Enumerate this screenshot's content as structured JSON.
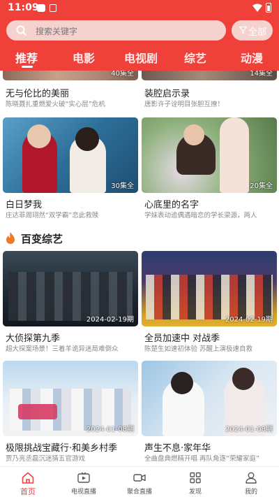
{
  "status_bar": {
    "time": "11:09"
  },
  "search": {
    "placeholder": "搜索关键字",
    "filter_label": "全部"
  },
  "tabs": [
    {
      "label": "推荐",
      "active": true
    },
    {
      "label": "电影"
    },
    {
      "label": "电视剧"
    },
    {
      "label": "综艺"
    },
    {
      "label": "动漫"
    }
  ],
  "drama_cards": [
    {
      "title": "无与伦比的美丽",
      "desc": "陈晓聂扎重燃爱火破“实心层”危机",
      "badge": "40集全"
    },
    {
      "title": "装腔启示录",
      "desc": "唐影许子诠明目张胆互撩！",
      "badge": "14集全"
    },
    {
      "title": "白日梦我",
      "desc": "庄达菲周翊然“双学霸”恋此救赎",
      "badge": "30集全"
    },
    {
      "title": "心底里的名字",
      "desc": "学妹表动追偶遇暗恋的学长梁源，两人",
      "badge": "20集全"
    }
  ],
  "variety_section": {
    "title": "百变综艺"
  },
  "variety_cards": [
    {
      "title": "大侦探第九季",
      "desc": "超大探案场景！三着羊诡异迷局难倒众",
      "badge": "2024-02-19期"
    },
    {
      "title": "全员加速中 对战季",
      "desc": "陈楚生如速初体验 苏醒上演极速自救",
      "badge": "2024-02-19期"
    },
    {
      "title": "极限挑战宝藏行·和美乡村季",
      "desc": "贾乃亮丞磊沉迷猜五官游戏",
      "badge": "2024-01-08期"
    },
    {
      "title": "声生不息·家年华",
      "desc": "全曲盘典燃精开唱 再队角逐“荣耀家庭”",
      "badge": "2024-01-08期"
    }
  ],
  "bottom_nav": [
    {
      "label": "首页",
      "icon": "home-icon",
      "active": true
    },
    {
      "label": "电视直播",
      "icon": "tv-live-icon"
    },
    {
      "label": "聚合直播",
      "icon": "video-camera-icon"
    },
    {
      "label": "发现",
      "icon": "discover-grid-icon"
    },
    {
      "label": "我的",
      "icon": "user-icon"
    }
  ],
  "colors": {
    "brand_red": "#f0403a",
    "search_bg": "#f6d2cf",
    "inactive_text": "#555555"
  }
}
